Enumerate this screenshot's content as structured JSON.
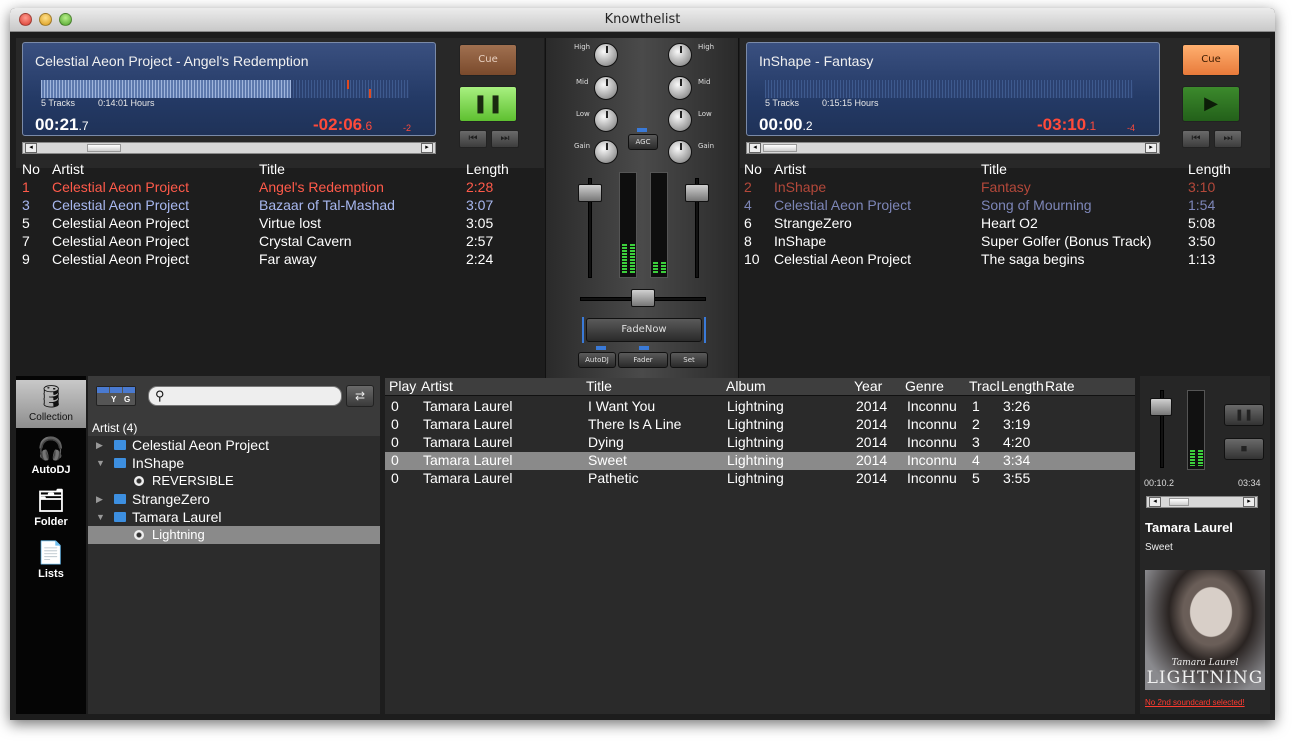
{
  "window": {
    "title": "Knowthelist"
  },
  "deck_a": {
    "track_name": "Celestial Aeon Project - Angel's Redemption",
    "tracks_count": "5 Tracks",
    "hours": "0:14:01 Hours",
    "elapsed_main": "00:21",
    "elapsed_frac": ".7",
    "remaining_main": "-02:06",
    "remaining_frac": ".6",
    "pitch": "-2",
    "cue_label": "Cue",
    "play_icon": "pause-icon",
    "play_symbol": "❚❚",
    "prev_symbol": "⏮",
    "next_symbol": "⏭",
    "progress": 0.14
  },
  "deck_b": {
    "track_name": "InShape - Fantasy",
    "tracks_count": "5 Tracks",
    "hours": "0:15:15 Hours",
    "elapsed_main": "00:00",
    "elapsed_frac": ".2",
    "remaining_main": "-03:10",
    "remaining_frac": ".1",
    "pitch": "-4",
    "cue_label": "Cue",
    "play_icon": "play-icon",
    "play_symbol": "▶",
    "prev_symbol": "⏮",
    "next_symbol": "⏭",
    "progress": 0.0
  },
  "playlist_headers": {
    "no": "No",
    "artist": "Artist",
    "title": "Title",
    "length": "Length"
  },
  "playlist_a": [
    {
      "no": "1",
      "artist": "Celestial Aeon Project",
      "title": "Angel's Redemption",
      "length": "2:28",
      "state": "current"
    },
    {
      "no": "3",
      "artist": "Celestial Aeon Project",
      "title": "Bazaar of Tal-Mashad",
      "length": "3:07",
      "state": "next"
    },
    {
      "no": "5",
      "artist": "Celestial Aeon Project",
      "title": "Virtue lost",
      "length": "3:05",
      "state": ""
    },
    {
      "no": "7",
      "artist": "Celestial Aeon Project",
      "title": "Crystal Cavern",
      "length": "2:57",
      "state": ""
    },
    {
      "no": "9",
      "artist": "Celestial Aeon Project",
      "title": "Far away",
      "length": "2:24",
      "state": ""
    }
  ],
  "playlist_b": [
    {
      "no": "2",
      "artist": "InShape",
      "title": "Fantasy",
      "length": "3:10",
      "state": "current"
    },
    {
      "no": "4",
      "artist": "Celestial Aeon Project",
      "title": "Song of Mourning",
      "length": "1:54",
      "state": "next"
    },
    {
      "no": "6",
      "artist": "StrangeZero",
      "title": "Heart O2",
      "length": "5:08",
      "state": ""
    },
    {
      "no": "8",
      "artist": "InShape",
      "title": "Super Golfer (Bonus Track)",
      "length": "3:50",
      "state": ""
    },
    {
      "no": "10",
      "artist": "Celestial Aeon Project",
      "title": "The saga begins",
      "length": "1:13",
      "state": ""
    }
  ],
  "mixer": {
    "high": "High",
    "mid": "Mid",
    "low": "Low",
    "gain": "Gain",
    "agc": "AGC",
    "fadenow": "FadeNow",
    "autodj": "AutoDJ",
    "fader": "Fader",
    "set": "Set",
    "vu_a_level": 0.3,
    "vu_b_level": 0.12,
    "crossfader": 0.5
  },
  "sidebar": [
    {
      "label": "Collection",
      "icon": "database-icon",
      "glyph": "🛢"
    },
    {
      "label": "AutoDJ",
      "icon": "headphones-icon",
      "glyph": "🎧"
    },
    {
      "label": "Folder",
      "icon": "folder-icon",
      "glyph": "🗂"
    },
    {
      "label": "Lists",
      "icon": "list-icon",
      "glyph": "📄"
    }
  ],
  "tree": {
    "mode_labels": [
      "Y",
      "G"
    ],
    "header": "Artist  (4)",
    "search_placeholder": "",
    "items": [
      {
        "label": "Celestial Aeon Project",
        "level": 0,
        "expanded": false
      },
      {
        "label": "InShape",
        "level": 0,
        "expanded": true
      },
      {
        "label": "REVERSIBLE",
        "level": 1,
        "expanded": false
      },
      {
        "label": "StrangeZero",
        "level": 0,
        "expanded": false
      },
      {
        "label": "Tamara Laurel",
        "level": 0,
        "expanded": true
      },
      {
        "label": "Lightning",
        "level": 1,
        "expanded": false,
        "selected": true
      }
    ]
  },
  "library": {
    "headers": {
      "played": "Played",
      "artist": "Artist",
      "title": "Title",
      "album": "Album",
      "year": "Year",
      "genre": "Genre",
      "track": "Track",
      "length": "Length",
      "rate": "Rate"
    },
    "rows": [
      {
        "played": "0",
        "artist": "Tamara Laurel",
        "title": "I Want You",
        "album": "Lightning",
        "year": "2014",
        "genre": "Inconnu",
        "track": "1",
        "length": "3:26"
      },
      {
        "played": "0",
        "artist": "Tamara Laurel",
        "title": "There Is A Line",
        "album": "Lightning",
        "year": "2014",
        "genre": "Inconnu",
        "track": "2",
        "length": "3:19"
      },
      {
        "played": "0",
        "artist": "Tamara Laurel",
        "title": "Dying",
        "album": "Lightning",
        "year": "2014",
        "genre": "Inconnu",
        "track": "3",
        "length": "4:20"
      },
      {
        "played": "0",
        "artist": "Tamara Laurel",
        "title": "Sweet",
        "album": "Lightning",
        "year": "2014",
        "genre": "Inconnu",
        "track": "4",
        "length": "3:34",
        "selected": true
      },
      {
        "played": "0",
        "artist": "Tamara Laurel",
        "title": "Pathetic",
        "album": "Lightning",
        "year": "2014",
        "genre": "Inconnu",
        "track": "5",
        "length": "3:55"
      }
    ]
  },
  "preview": {
    "time_elapsed": "00:10.2",
    "time_total": "03:34",
    "artist": "Tamara Laurel",
    "title": "Sweet",
    "cover_text": "LIGHTNING",
    "cover_subtext": "Tamara Laurel",
    "warning": "No 2nd soundcard selected!",
    "warning_color": "#ff3b30",
    "pause_symbol": "❚❚",
    "stop_symbol": "■"
  }
}
